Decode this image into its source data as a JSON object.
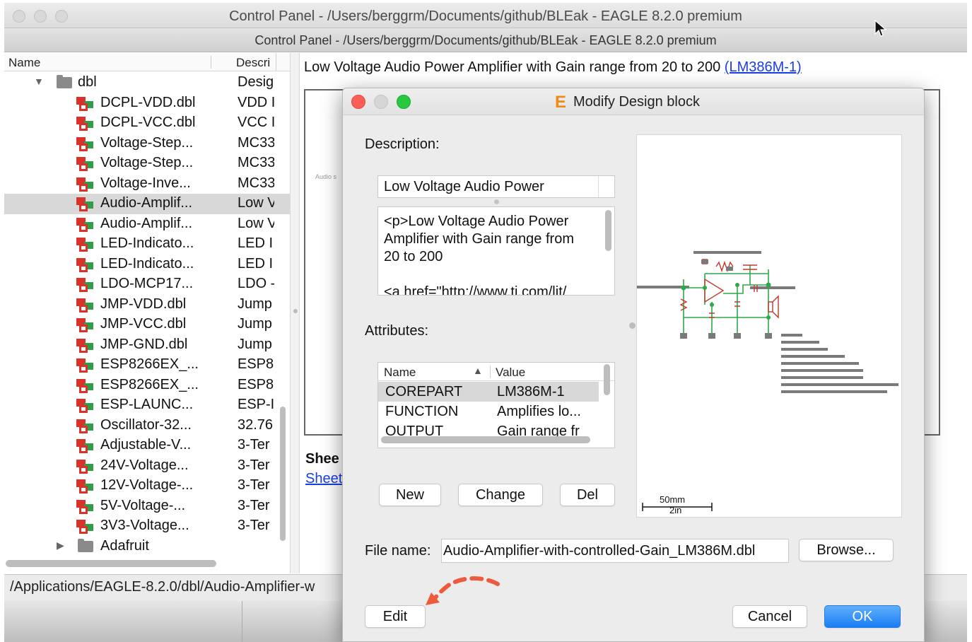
{
  "window": {
    "title": "Control Panel - /Users/berggrm/Documents/github/BLEak - EAGLE 8.2.0 premium",
    "subtitle": "Control Panel - /Users/berggrm/Documents/github/BLEak - EAGLE 8.2.0 premium"
  },
  "tree": {
    "col_name": "Name",
    "col_desc": "Descri",
    "folder": {
      "name": "dbl",
      "desc": "Desig"
    },
    "items": [
      {
        "name": "DCPL-VDD.dbl",
        "desc": "VDD I"
      },
      {
        "name": "DCPL-VCC.dbl",
        "desc": "VCC I"
      },
      {
        "name": "Voltage-Step...",
        "desc": "MC33"
      },
      {
        "name": "Voltage-Step...",
        "desc": "MC33"
      },
      {
        "name": "Voltage-Inve...",
        "desc": "MC33"
      },
      {
        "name": "Audio-Amplif...",
        "desc": "Low V"
      },
      {
        "name": "Audio-Amplif...",
        "desc": "Low V"
      },
      {
        "name": "LED-Indicato...",
        "desc": "LED I"
      },
      {
        "name": "LED-Indicato...",
        "desc": "LED I"
      },
      {
        "name": "LDO-MCP17...",
        "desc": "LDO -"
      },
      {
        "name": "JMP-VDD.dbl",
        "desc": "Jump"
      },
      {
        "name": "JMP-VCC.dbl",
        "desc": "Jump"
      },
      {
        "name": "JMP-GND.dbl",
        "desc": "Jump"
      },
      {
        "name": "ESP8266EX_...",
        "desc": "ESP8"
      },
      {
        "name": "ESP8266EX_...",
        "desc": "ESP8"
      },
      {
        "name": "ESP-LAUNC...",
        "desc": "ESP-I"
      },
      {
        "name": "Oscillator-32...",
        "desc": "32.76"
      },
      {
        "name": "Adjustable-V...",
        "desc": "3-Ter"
      },
      {
        "name": "24V-Voltage...",
        "desc": "3-Ter"
      },
      {
        "name": "12V-Voltage-...",
        "desc": "3-Ter"
      },
      {
        "name": "5V-Voltage-...",
        "desc": "3-Ter"
      },
      {
        "name": "3V3-Voltage...",
        "desc": "3-Ter"
      }
    ],
    "folder2": {
      "name": "Adafruit"
    }
  },
  "content": {
    "headline": "Low Voltage Audio Power Amplifier with Gain range from 20 to 200 ",
    "headline_link": "(LM386M-1)",
    "preview_tiny_label": "Audio s",
    "sheets_label": "Shee",
    "sheets_link": "Sheet"
  },
  "statusbar": {
    "path": "/Applications/EAGLE-8.2.0/dbl/Audio-Amplifier-w"
  },
  "dialog": {
    "title": "Modify Design block",
    "title_icon": "E",
    "description_label": "Description:",
    "description_short": "Low Voltage Audio Power",
    "description_long_lines": [
      "<p>Low Voltage Audio Power",
      "Amplifier with Gain range from",
      "20 to 200",
      "",
      "<a href=\"http://www.ti.com/lit/"
    ],
    "attributes_label": "Attributes:",
    "attributes": {
      "col_name": "Name",
      "col_value": "Value",
      "rows": [
        {
          "name": "COREPART",
          "value": "LM386M-1"
        },
        {
          "name": "FUNCTION",
          "value": "Amplifies lo..."
        },
        {
          "name": "OUTPUT",
          "value": "Gain range fr"
        }
      ]
    },
    "buttons": {
      "new": "New",
      "change": "Change",
      "del": "Del",
      "browse": "Browse...",
      "edit": "Edit",
      "cancel": "Cancel",
      "ok": "OK"
    },
    "filename_label": "File name:",
    "filename_value": "Audio-Amplifier-with-controlled-Gain_LM386M.dbl",
    "scale_mm": "50mm",
    "scale_in": "2in"
  },
  "colors": {
    "link": "#1a3ee6",
    "ok_button": "#1b7ef5",
    "traffic_red": "#fc5f57",
    "traffic_green": "#28c840",
    "annotation_arrow": "#ee5a3c",
    "eagle_icon": "#f08a16",
    "schematic_red": "#c0392b",
    "schematic_green": "#2ea84a"
  },
  "icons": {
    "tree_item": "design-block-icon",
    "folder": "folder-icon",
    "cursor": "mouse-pointer-icon"
  }
}
